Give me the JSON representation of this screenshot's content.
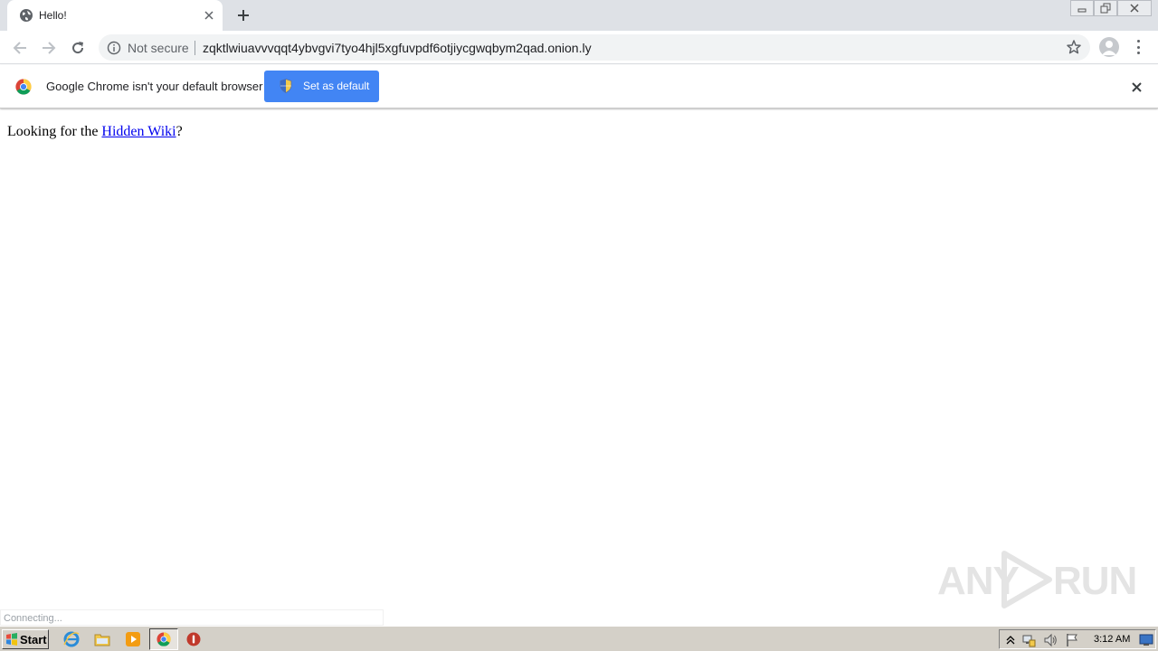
{
  "browser": {
    "tab": {
      "title": "Hello!",
      "favicon": "globe-icon"
    },
    "new_tab_icon": "plus-icon",
    "window_controls": [
      "minimize-icon",
      "restore-icon",
      "close-icon"
    ]
  },
  "toolbar": {
    "back_icon": "arrow-left-icon",
    "forward_icon": "arrow-right-icon",
    "reload_icon": "reload-icon",
    "security_label": "Not secure",
    "url": "zqktlwiuavvvqqt4ybvgvi7tyo4hjl5xgfuvpdf6otjiycgwqbym2qad.onion.ly",
    "bookmark_icon": "star-icon",
    "profile_icon": "avatar-icon",
    "menu_icon": "kebab-menu-icon"
  },
  "infobar": {
    "message": "Google Chrome isn't your default browser",
    "button_label": "Set as default",
    "button_color": "#4285f4"
  },
  "page": {
    "text_before": "Looking for the ",
    "link_text": "Hidden Wiki",
    "text_after": "?"
  },
  "status_bubble": "Connecting...",
  "watermark": {
    "left": "ANY",
    "right": "RUN"
  },
  "taskbar": {
    "start_label": "Start",
    "clock": "3:12 AM",
    "apps": [
      "ie-icon",
      "explorer-icon",
      "media-player-icon",
      "chrome-icon",
      "stop-icon"
    ]
  }
}
